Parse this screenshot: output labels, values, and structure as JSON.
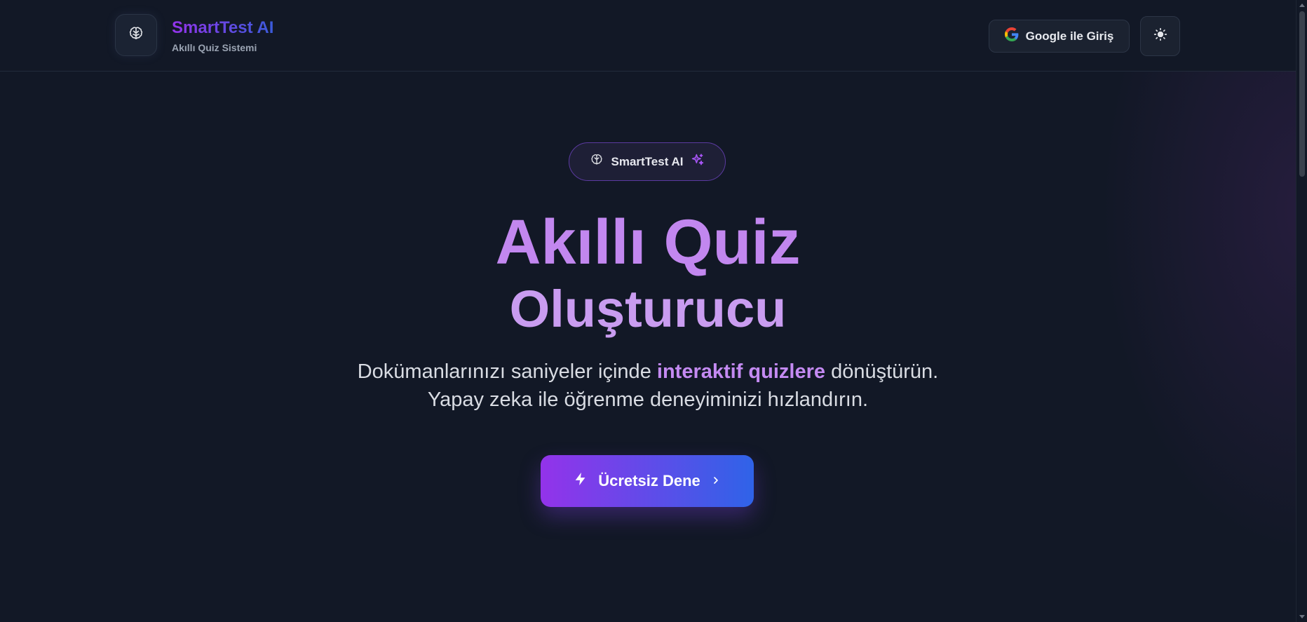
{
  "header": {
    "brand_title": "SmartTest AI",
    "brand_subtitle": "Akıllı Quiz Sistemi",
    "logo_icon": "brain-icon",
    "login_button_label": "Google ile Giriş",
    "login_icon": "google-icon",
    "theme_toggle_icon": "sun-icon"
  },
  "hero": {
    "badge_label": "SmartTest AI",
    "badge_icons": [
      "brain-icon",
      "sparkles-icon"
    ],
    "title_line1": "Akıllı Quiz",
    "title_line2": "Oluşturucu",
    "description_line1_before": "Dokümanlarınızı saniyeler içinde ",
    "description_line1_highlight": "interaktif quizlere",
    "description_line1_after": " dönüştürün.",
    "description_line2": "Yapay zeka ile öğrenme deneyiminizi hızlandırın.",
    "cta_label": "Ücretsiz Dene",
    "cta_icons": [
      "lightning-icon",
      "chevron-right-icon"
    ]
  },
  "colors": {
    "background": "#121826",
    "accent_purple": "#9333ea",
    "accent_blue": "#2f63e8",
    "title_purple": "#c287ef"
  }
}
